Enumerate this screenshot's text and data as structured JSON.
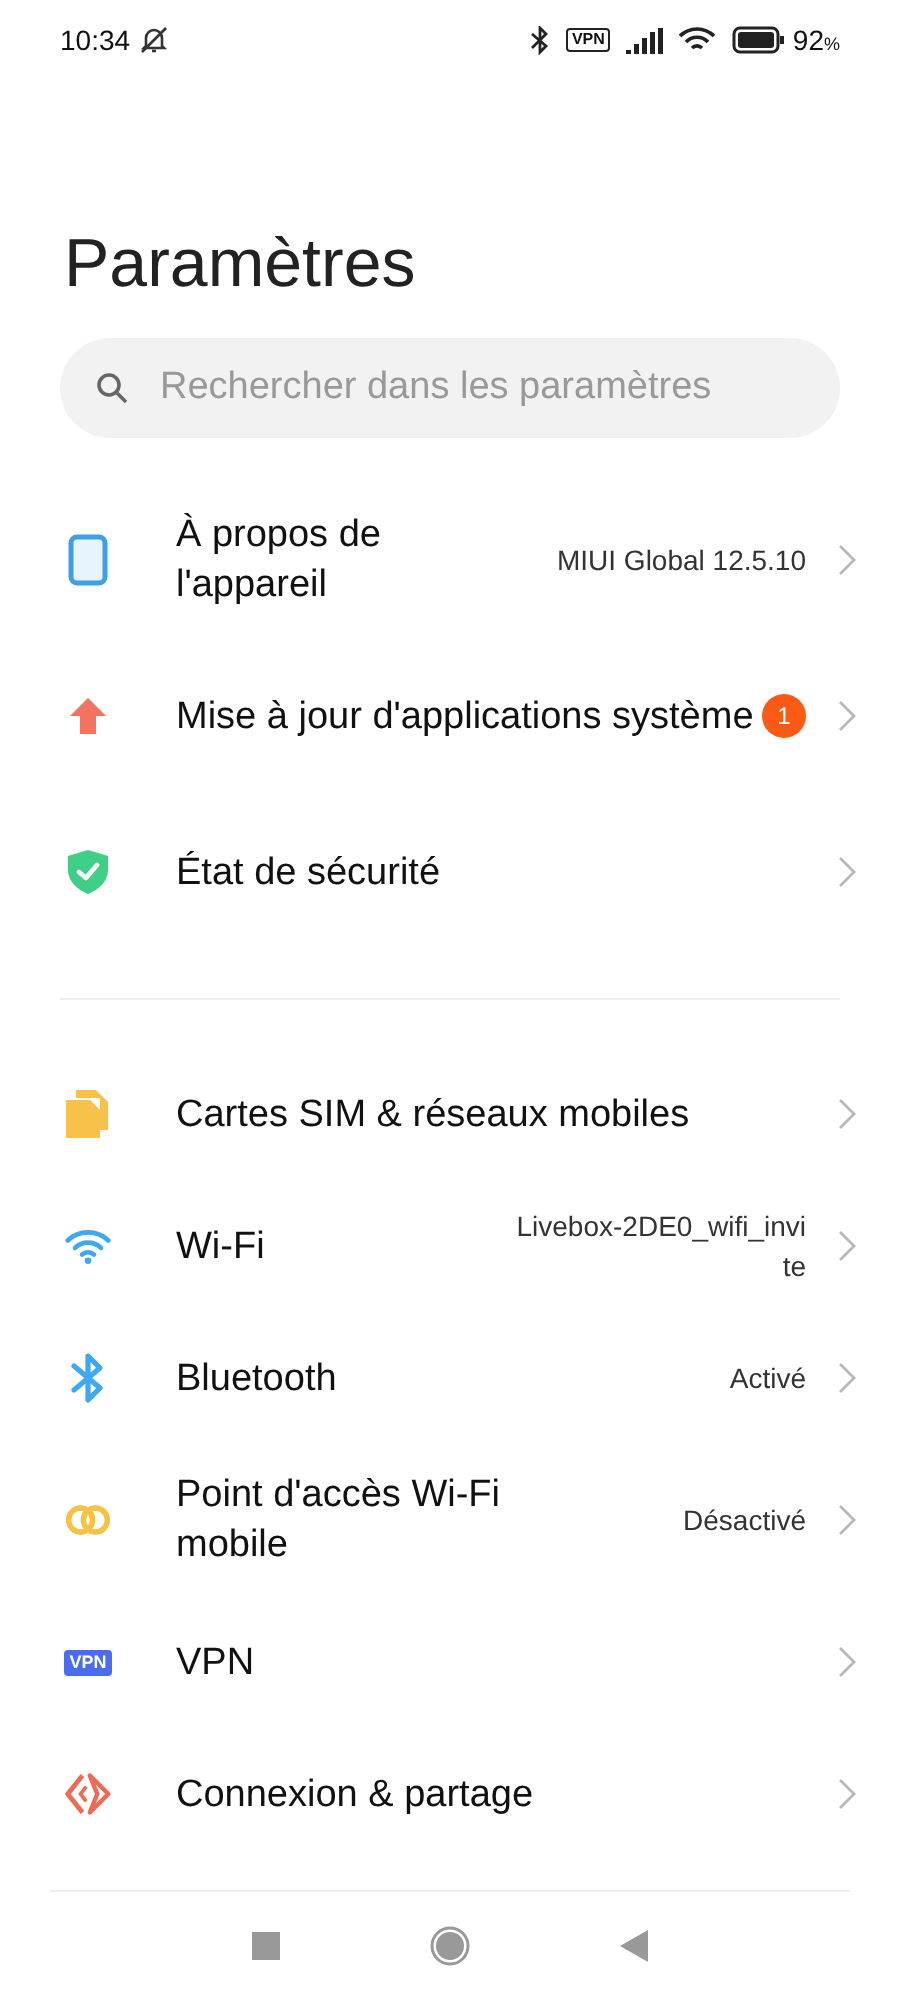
{
  "status_bar": {
    "time": "10:34",
    "vpn_badge": "VPN",
    "battery_percent": "92",
    "battery_unit": "%"
  },
  "title": "Paramètres",
  "search": {
    "placeholder": "Rechercher dans les paramètres"
  },
  "groups": [
    {
      "items": [
        {
          "kind": "phone",
          "label": "À propos de l'appareil",
          "value": "MIUI Global 12.5.10"
        },
        {
          "kind": "update",
          "label": "Mise à jour d'applications système",
          "badge": "1"
        },
        {
          "kind": "security",
          "label": "État de sécurité"
        }
      ]
    },
    {
      "items": [
        {
          "kind": "sim",
          "label": "Cartes SIM & réseaux mobiles"
        },
        {
          "kind": "wifi",
          "label": "Wi-Fi",
          "value": "Livebox-2DE0_wifi_invite"
        },
        {
          "kind": "bluetooth",
          "label": "Bluetooth",
          "value": "Activé"
        },
        {
          "kind": "hotspot",
          "label": "Point d'accès Wi-Fi mobile",
          "value": "Désactivé"
        },
        {
          "kind": "vpn",
          "label": "VPN",
          "icon_text": "VPN"
        },
        {
          "kind": "share",
          "label": "Connexion & partage"
        }
      ]
    }
  ]
}
